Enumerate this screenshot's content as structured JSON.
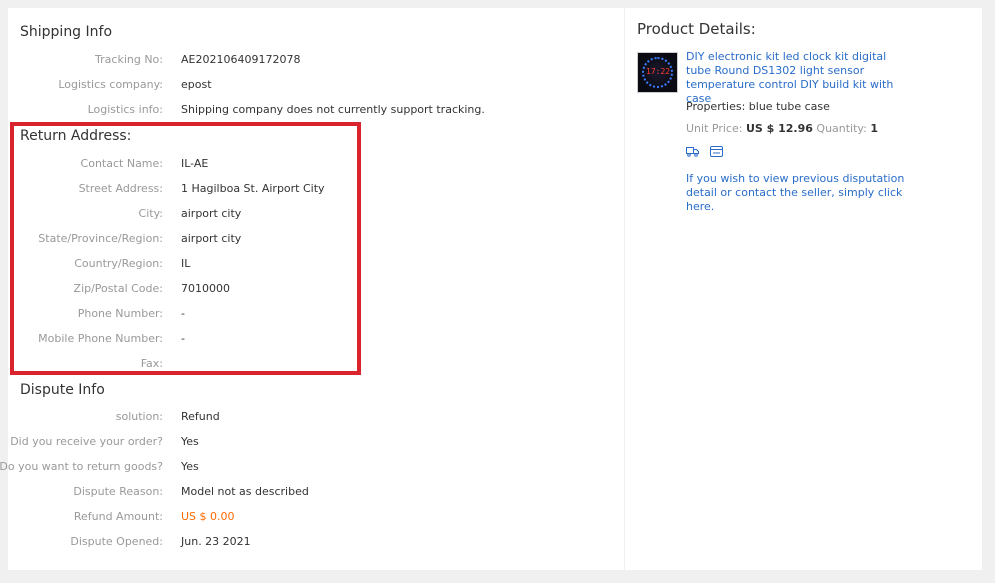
{
  "shipping": {
    "title": "Shipping Info",
    "fields": [
      {
        "label": "Tracking No:",
        "value": "AE202106409172078"
      },
      {
        "label": "Logistics company:",
        "value": "epost"
      },
      {
        "label": "Logistics info:",
        "value": "Shipping company does not currently support tracking."
      }
    ]
  },
  "return_address": {
    "title": "Return Address:",
    "highlight_color": "#d9232d",
    "fields": [
      {
        "label": "Contact Name:",
        "value": "IL-AE"
      },
      {
        "label": "Street Address:",
        "value": "1 Hagilboa St. Airport City"
      },
      {
        "label": "City:",
        "value": "airport city"
      },
      {
        "label": "State/Province/Region:",
        "value": "airport city"
      },
      {
        "label": "Country/Region:",
        "value": "IL"
      },
      {
        "label": "Zip/Postal Code:",
        "value": "7010000"
      },
      {
        "label": "Phone Number:",
        "value": "-"
      },
      {
        "label": "Mobile Phone Number:",
        "value": "-"
      },
      {
        "label": "Fax:",
        "value": ""
      }
    ]
  },
  "dispute": {
    "title": "Dispute Info",
    "fields": [
      {
        "label": "solution:",
        "value": "Refund"
      },
      {
        "label": "Did you receive your order?",
        "value": "Yes"
      },
      {
        "label": "Do you want to return goods?",
        "value": "Yes"
      },
      {
        "label": "Dispute Reason:",
        "value": "Model not as described"
      },
      {
        "label": "Refund Amount:",
        "value": "US $ 0.00"
      },
      {
        "label": "Dispute Opened:",
        "value": "Jun. 23 2021"
      }
    ],
    "refund_color": "#ff6a00"
  },
  "product": {
    "title": "Product Details:",
    "thumb_digits": "17:22",
    "name": "DIY electronic kit led clock kit digital tube Round DS1302 light sensor temperature control DIY build kit with case",
    "properties": "Properties: blue tube case",
    "unit_price_label": "Unit Price:",
    "unit_price": "US $ 12.96",
    "quantity_label": "Quantity:",
    "quantity": "1",
    "icons": [
      "shipping-icon",
      "card-icon"
    ],
    "dispute_link": "If you wish to view previous disputation detail or contact the seller, simply click here.",
    "link_color": "#2a6dc9"
  }
}
